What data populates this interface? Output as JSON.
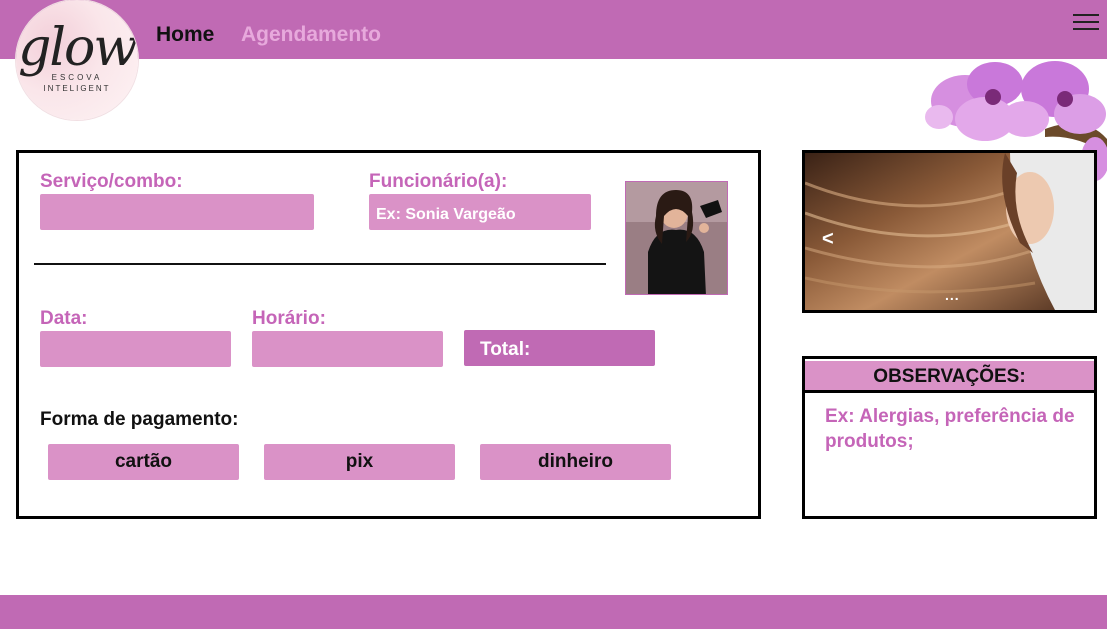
{
  "logo": {
    "script": "glow",
    "line1": "ESCOVA",
    "line2": "INTELIGENT"
  },
  "nav": {
    "home": "Home",
    "agenda": "Agendamento"
  },
  "form": {
    "servico_label": "Serviço/combo:",
    "funcionario_label": "Funcionário(a):",
    "funcionario_placeholder": "Ex: Sonia Vargeão",
    "data_label": "Data:",
    "horario_label": "Horário:",
    "total_label": "Total:",
    "pagamento_title": "Forma de pagamento:",
    "payment_options": [
      "cartão",
      "pix",
      "dinheiro"
    ]
  },
  "carousel": {
    "prev": "<",
    "dots": "..."
  },
  "observacoes": {
    "title": "OBSERVAÇÕES:",
    "placeholder": "Ex: Alergias, preferência de produtos;"
  },
  "colors": {
    "primary": "#c06ab4",
    "field": "#da92c7",
    "label": "#c565b8",
    "nav_inactive": "#e7a9dc"
  }
}
